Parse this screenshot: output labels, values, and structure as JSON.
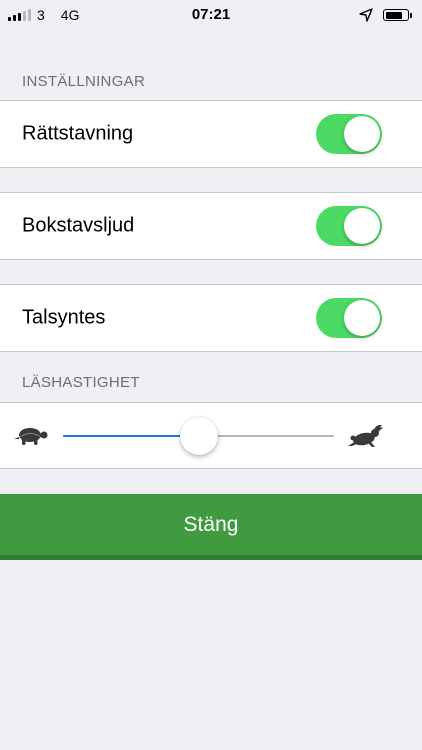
{
  "status_bar": {
    "signal_bars_active": 3,
    "carrier": "3",
    "network": "4G",
    "time": "07:21",
    "battery_level": 0.8
  },
  "settings": {
    "section_title": "INSTÄLLNINGAR",
    "items": [
      {
        "label": "Rättstavning",
        "enabled": true
      },
      {
        "label": "Bokstavsljud",
        "enabled": true
      },
      {
        "label": "Talsyntes",
        "enabled": true
      }
    ]
  },
  "reading_speed": {
    "section_title": "LÄSHASTIGHET",
    "value": 0.5,
    "min_icon": "turtle-icon",
    "max_icon": "rabbit-icon"
  },
  "colors": {
    "toggle_on": "#4cd964",
    "slider_fill": "#1c78d6",
    "close_button": "#3f9a40"
  },
  "close_button": {
    "label": "Stäng"
  }
}
